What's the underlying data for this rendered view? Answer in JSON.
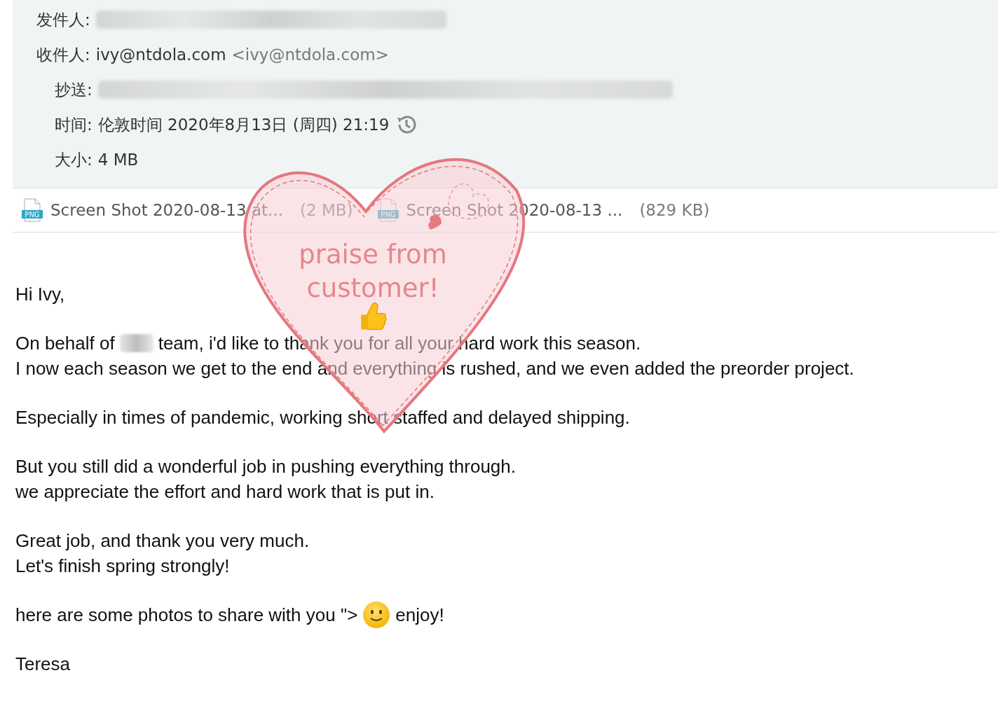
{
  "header": {
    "fields": [
      {
        "label": "发件人:",
        "kind": "redacted",
        "indented": false
      },
      {
        "label": "收件人:",
        "kind": "address",
        "indented": false,
        "value": "ivy@ntdola.com",
        "address": "<ivy@ntdola.com>"
      },
      {
        "label": "抄送:",
        "kind": "redacted",
        "indented": true
      },
      {
        "label": "时间:",
        "kind": "time",
        "indented": true,
        "value": "伦敦时间 2020年8月13日 (周四) 21:19"
      },
      {
        "label": "大小:",
        "kind": "text",
        "indented": true,
        "value": "4 MB"
      }
    ]
  },
  "attachments": [
    {
      "type": "PNG",
      "name": "Screen Shot 2020-08-13 at...",
      "size": "(2 MB)"
    },
    {
      "type": "PNG",
      "name": "Screen Shot 2020-08-13 ...",
      "size": "(829 KB)"
    }
  ],
  "body": {
    "paragraphs": [
      [
        {
          "text": "Hi Ivy,"
        }
      ],
      [
        {
          "parts": [
            {
              "kind": "text",
              "text": "On behalf of"
            },
            {
              "kind": "redacted"
            },
            {
              "kind": "text",
              "text": "team, i'd like to thank you for all your hard work this season."
            }
          ]
        },
        {
          "text": "I now each season we get to the end and everything is rushed, and we even added the preorder project."
        }
      ],
      [
        {
          "text": "Especially in times of pandemic, working short staffed and delayed shipping."
        }
      ],
      [
        {
          "text": "But you still did a wonderful job in pushing everything through."
        },
        {
          "text": "we appreciate the effort and hard work that is put in."
        }
      ],
      [
        {
          "text": "Great job, and thank you very much."
        },
        {
          "text": "Let's finish spring strongly!"
        }
      ],
      [
        {
          "parts": [
            {
              "kind": "text",
              "text": "here are some photos to share with you \">"
            },
            {
              "kind": "smiley"
            },
            {
              "kind": "text",
              "text": "enjoy!"
            }
          ]
        }
      ],
      [
        {
          "text": "Teresa"
        }
      ]
    ]
  },
  "sticker": {
    "text": "praise from customer!"
  }
}
